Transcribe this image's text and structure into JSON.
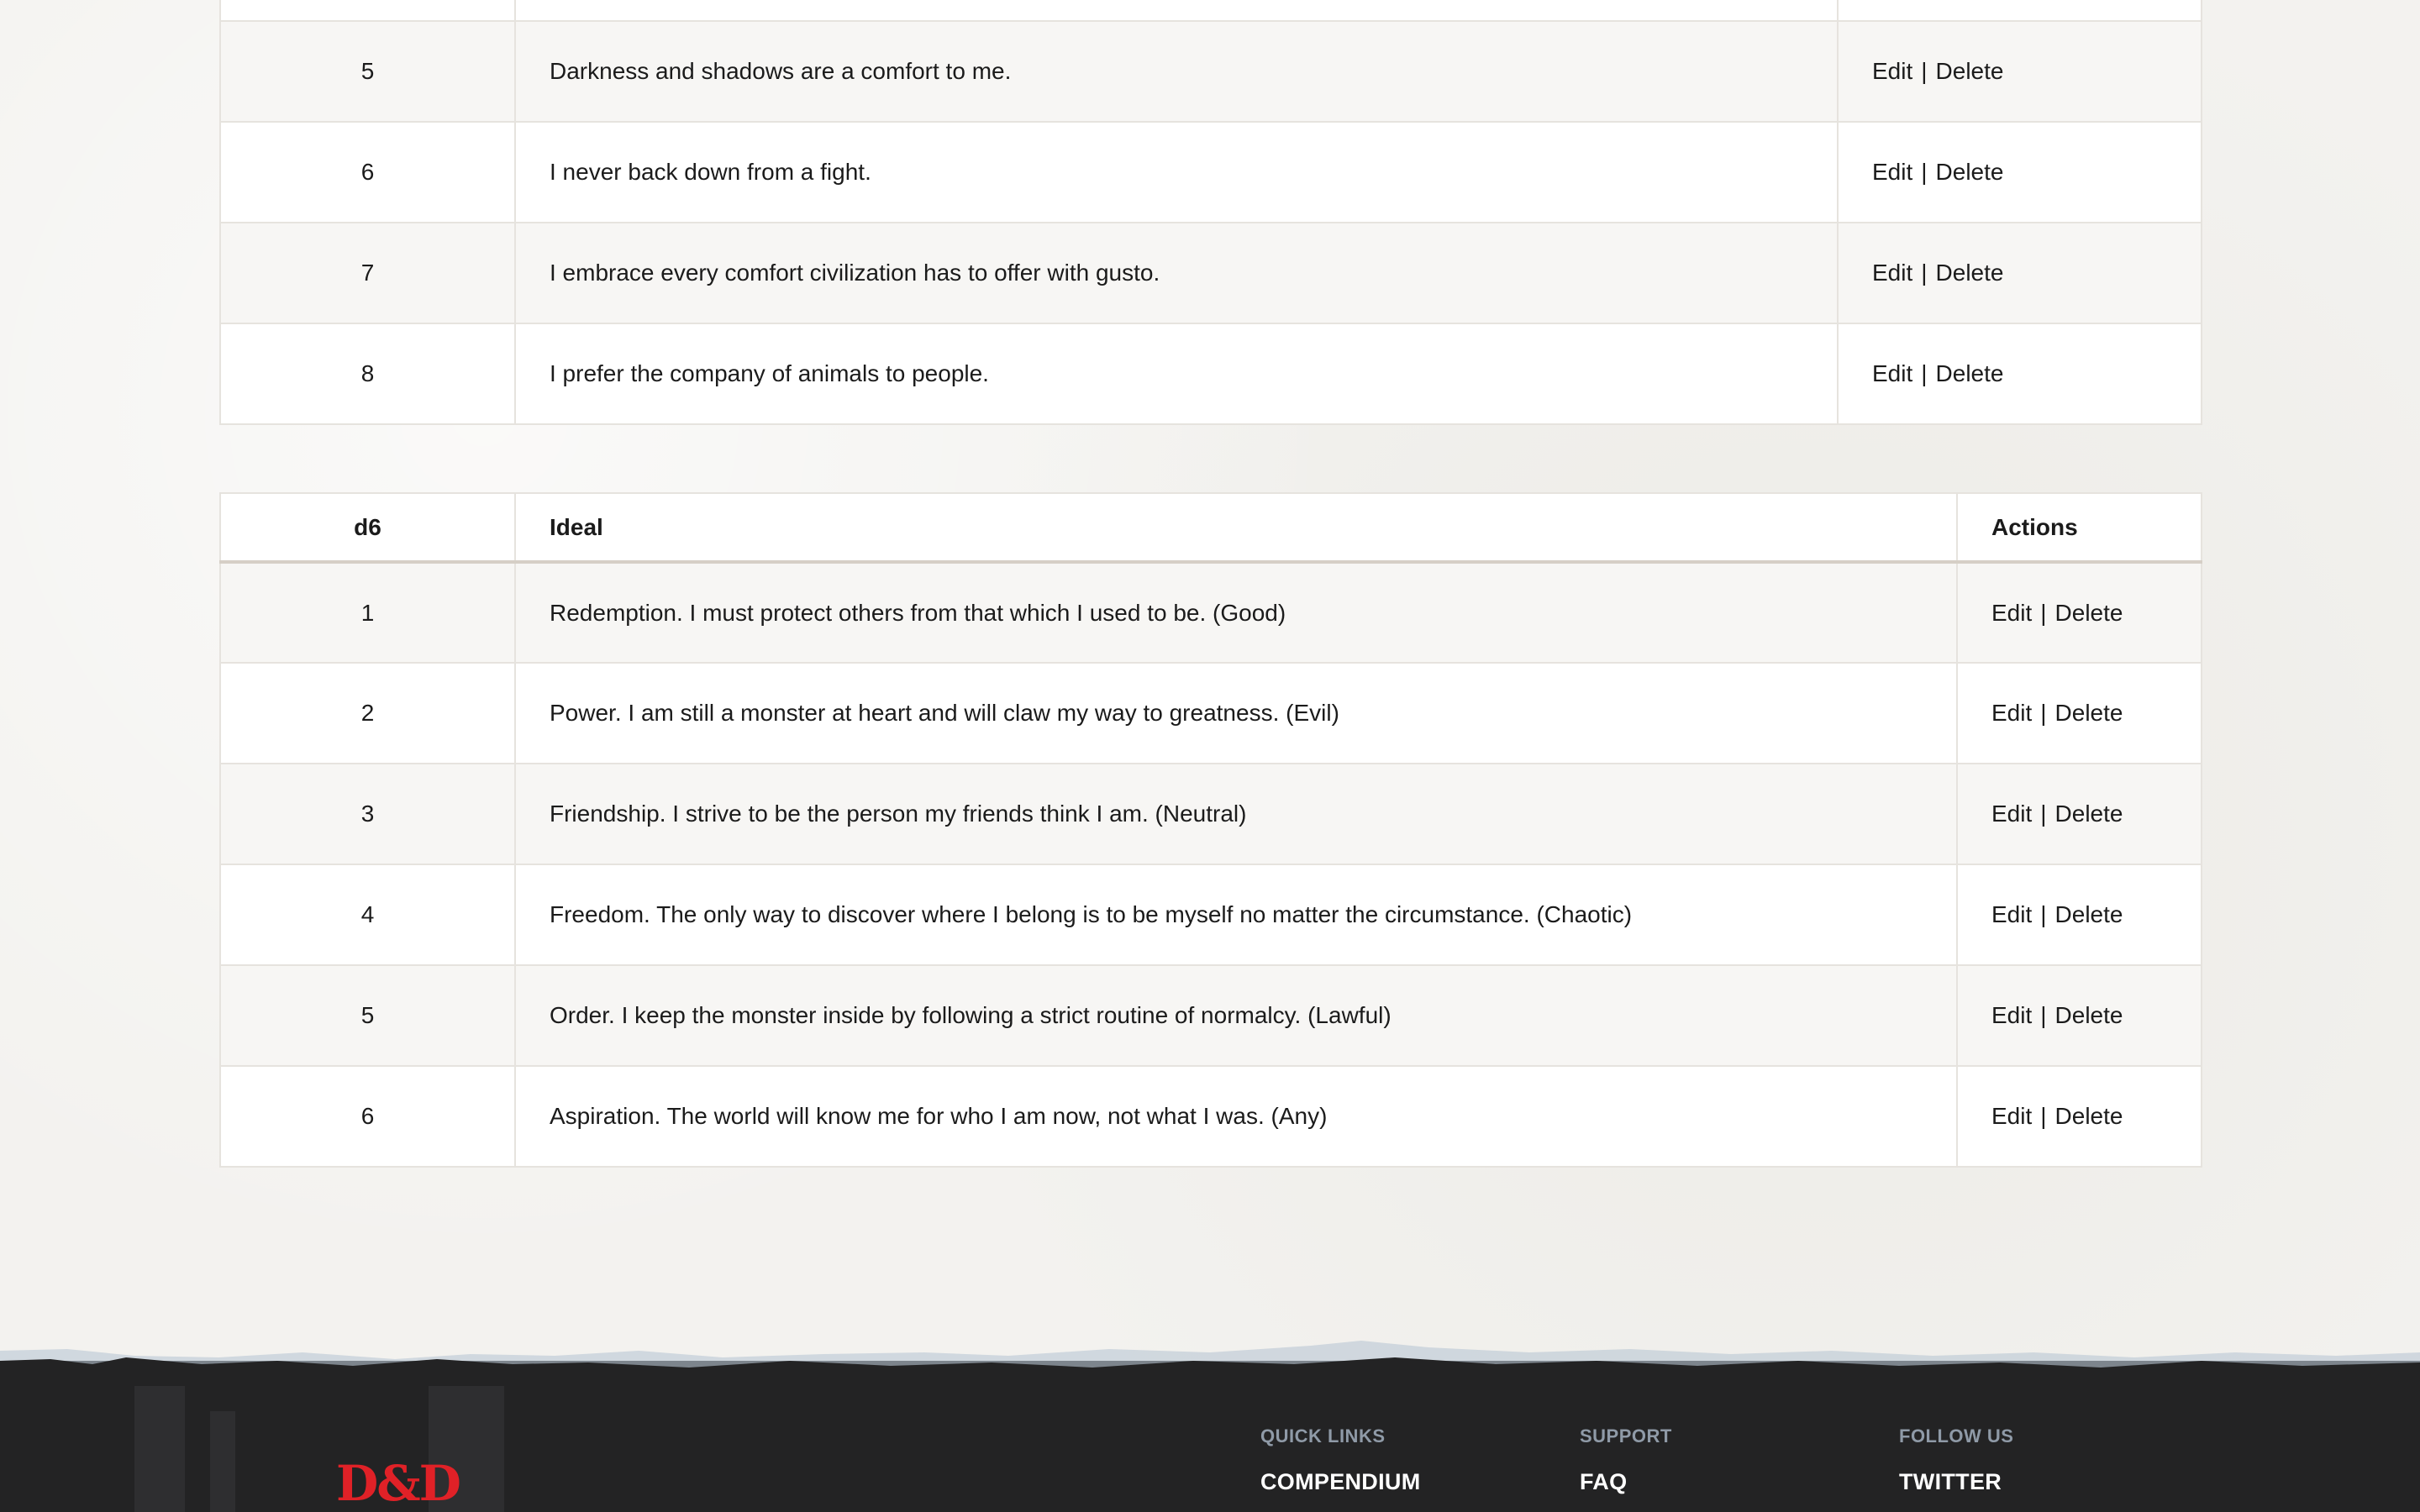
{
  "traits_table": {
    "rows": [
      {
        "num": "5",
        "text": "Darkness and shadows are a comfort to me."
      },
      {
        "num": "6",
        "text": "I never back down from a fight."
      },
      {
        "num": "7",
        "text": "I embrace every comfort civilization has to offer with gusto."
      },
      {
        "num": "8",
        "text": "I prefer the company of animals to people."
      }
    ],
    "edit_label": "Edit",
    "separator": "|",
    "delete_label": "Delete"
  },
  "ideals_table": {
    "headers": {
      "die": "d6",
      "ideal": "Ideal",
      "actions": "Actions"
    },
    "rows": [
      {
        "num": "1",
        "text": "Redemption. I must protect others from that which I used to be. (Good)"
      },
      {
        "num": "2",
        "text": "Power. I am still a monster at heart and will claw my way to greatness. (Evil)"
      },
      {
        "num": "3",
        "text": "Friendship. I strive to be the person my friends think I am. (Neutral)"
      },
      {
        "num": "4",
        "text": "Freedom. The only way to discover where I belong is to be myself no matter the circumstance. (Chaotic)"
      },
      {
        "num": "5",
        "text": "Order. I keep the monster inside by following a strict routine of normalcy. (Lawful)"
      },
      {
        "num": "6",
        "text": "Aspiration. The world will know me for who I am now, not what I was. (Any)"
      }
    ],
    "edit_label": "Edit",
    "separator": "|",
    "delete_label": "Delete"
  },
  "footer": {
    "logo": "D&D",
    "logo_color": "#e02127",
    "columns": [
      {
        "heading": "QUICK LINKS",
        "link": "COMPENDIUM"
      },
      {
        "heading": "SUPPORT",
        "link": "FAQ"
      },
      {
        "heading": "FOLLOW US",
        "link": "TWITTER"
      }
    ]
  }
}
